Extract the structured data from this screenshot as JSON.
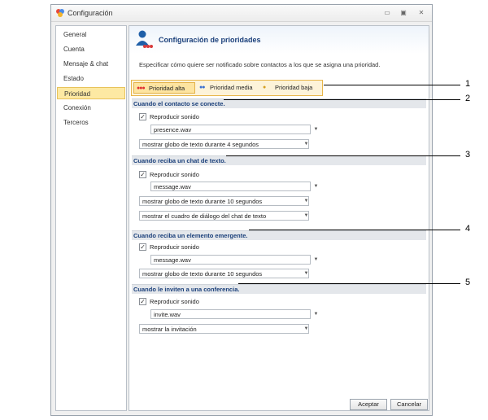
{
  "window": {
    "title": "Configuración"
  },
  "sidebar": {
    "items": [
      {
        "label": "General"
      },
      {
        "label": "Cuenta"
      },
      {
        "label": "Mensaje & chat"
      },
      {
        "label": "Estado"
      },
      {
        "label": "Prioridad",
        "active": true
      },
      {
        "label": "Conexión"
      },
      {
        "label": "Terceros"
      }
    ]
  },
  "header": {
    "title": "Configuración de prioridades",
    "description": "Especificar cómo quiere ser notificado sobre contactos a los que se asigna una prioridad."
  },
  "tabs": [
    {
      "label": "Prioridad alta",
      "dots": "●●●",
      "active": true
    },
    {
      "label": "Prioridad media",
      "dots": "●●"
    },
    {
      "label": "Prioridad baja",
      "dots": "●"
    }
  ],
  "sections": [
    {
      "title": "Cuando el contacto se conecte.",
      "check": "Reproducir sonido",
      "dropdowns": [
        "presence.wav",
        "mostrar globo de texto durante 4 segundos"
      ]
    },
    {
      "title": "Cuando reciba un chat de texto.",
      "check": "Reproducir sonido",
      "dropdowns": [
        "message.wav",
        "mostrar globo de texto durante 10 segundos",
        "mostrar el cuadro de diálogo del chat de texto"
      ]
    },
    {
      "title": "Cuando reciba un elemento emergente.",
      "check": "Reproducir sonido",
      "dropdowns": [
        "message.wav",
        "mostrar globo de texto durante 10 segundos"
      ]
    },
    {
      "title": "Cuando le inviten a una conferencia.",
      "check": "Reproducir sonido",
      "dropdowns": [
        "invite.wav",
        "mostrar la invitación"
      ]
    }
  ],
  "footer": {
    "accept": "Aceptar",
    "cancel": "Cancelar"
  },
  "callouts": [
    "1",
    "2",
    "3",
    "4",
    "5"
  ],
  "colors": {
    "accent": "#1a3f7a",
    "tab_active": "#fde4a0",
    "sidebar_active": "#fde9a3",
    "dots_alta": "#e03030",
    "dots_media": "#3a6fd0",
    "dots_baja": "#d7a020"
  }
}
